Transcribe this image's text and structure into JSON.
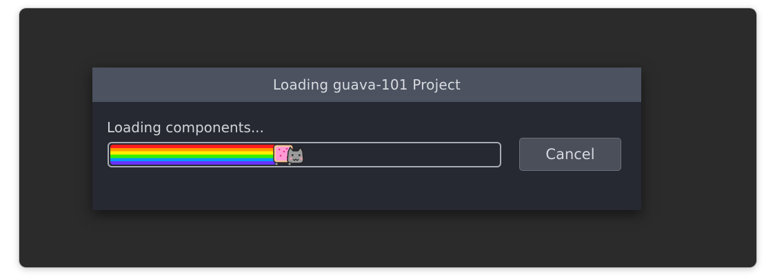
{
  "dialog": {
    "title": "Loading guava-101 Project",
    "status": "Loading components...",
    "progress": 0.43,
    "cancel_label": "Cancel"
  },
  "colors": {
    "window_bg": "#2b2b2b",
    "dialog_bg": "#262931",
    "titlebar_bg": "#4c5260",
    "button_bg": "#4a4f5a"
  },
  "icons": {
    "progress_indicator": "nyan-cat-icon"
  }
}
